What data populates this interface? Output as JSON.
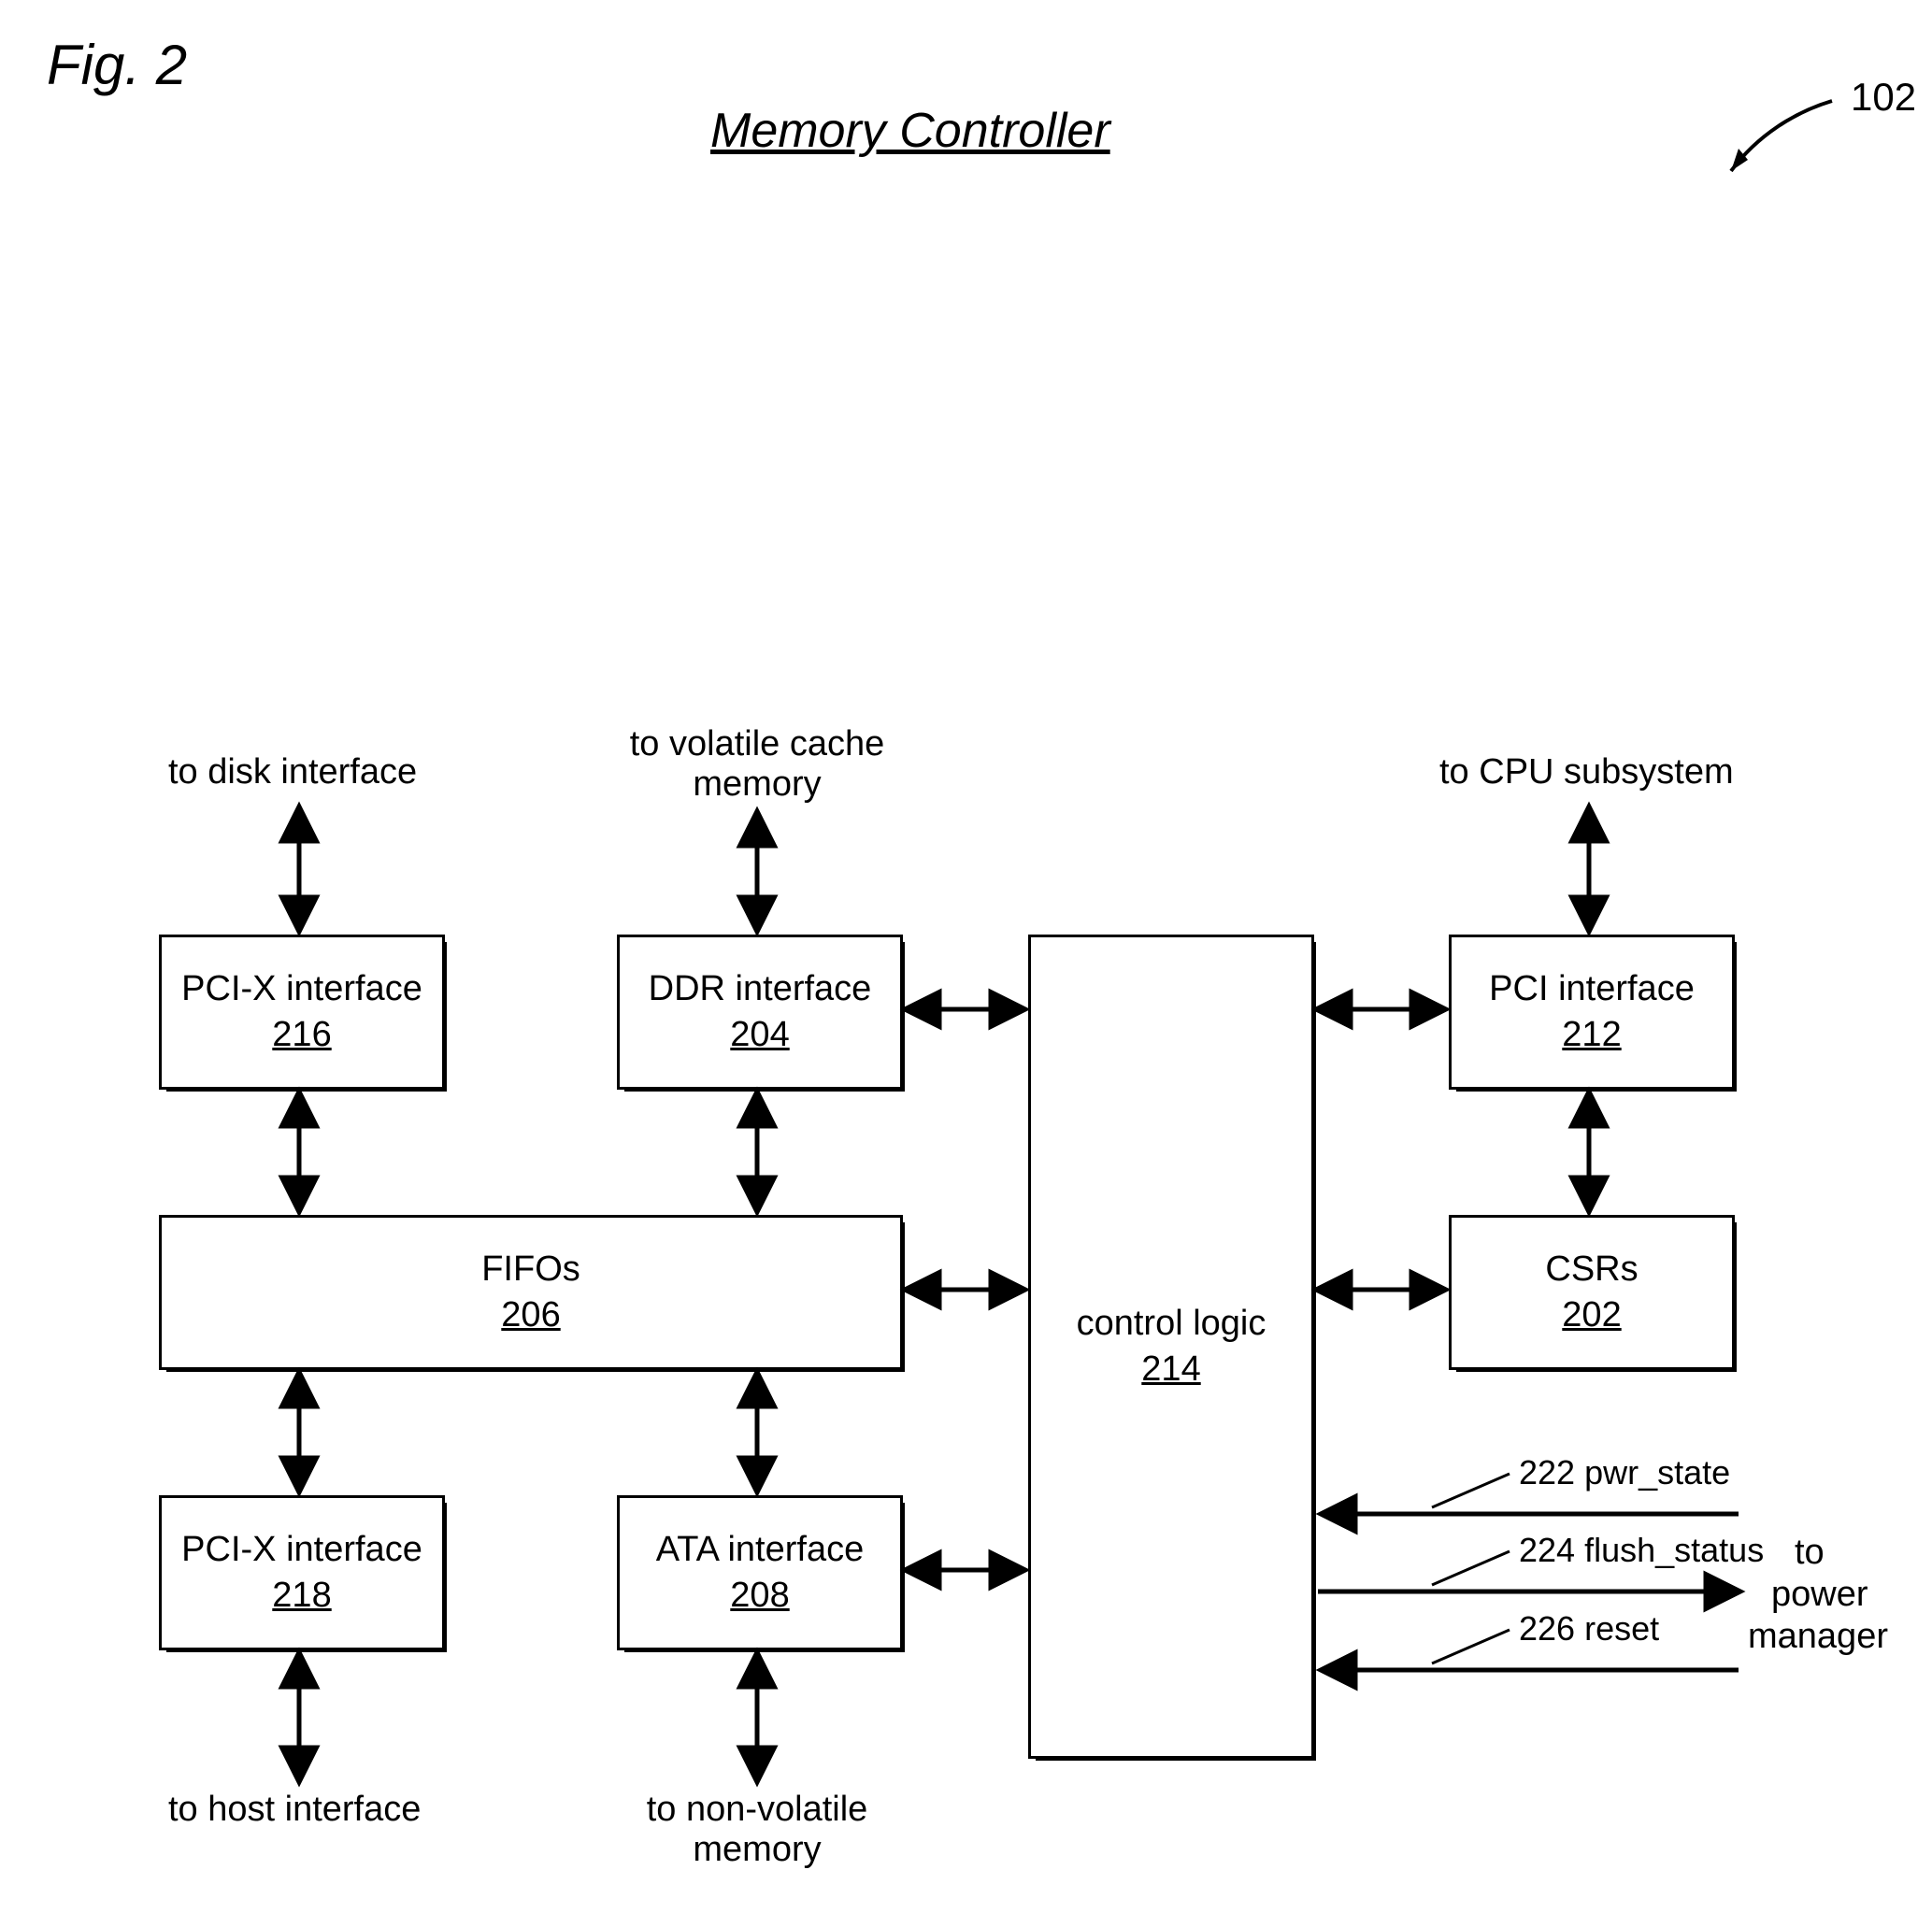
{
  "figure_label": "Fig. 2",
  "title": "Memory Controller",
  "ref": "102",
  "blocks": {
    "pcix_top": {
      "label": "PCI-X interface",
      "num": "216"
    },
    "ddr": {
      "label": "DDR interface",
      "num": "204"
    },
    "pci": {
      "label": "PCI interface",
      "num": "212"
    },
    "fifos": {
      "label": "FIFOs",
      "num": "206"
    },
    "csrs": {
      "label": "CSRs",
      "num": "202"
    },
    "pcix_bot": {
      "label": "PCI-X interface",
      "num": "218"
    },
    "ata": {
      "label": "ATA interface",
      "num": "208"
    },
    "ctrl": {
      "label": "control logic",
      "num": "214"
    }
  },
  "ext_labels": {
    "disk": "to disk interface",
    "vcache1": "to volatile cache",
    "vcache2": "memory",
    "cpu": "to CPU subsystem",
    "host": "to host interface",
    "nv1": "to non-volatile",
    "nv2": "memory",
    "pm1": "to",
    "pm2": "power",
    "pm3": "manager"
  },
  "signals": {
    "pwr_state": {
      "num": "222",
      "name": "pwr_state"
    },
    "flush_status": {
      "num": "224",
      "name": "flush_status"
    },
    "reset": {
      "num": "226",
      "name": "reset"
    }
  }
}
